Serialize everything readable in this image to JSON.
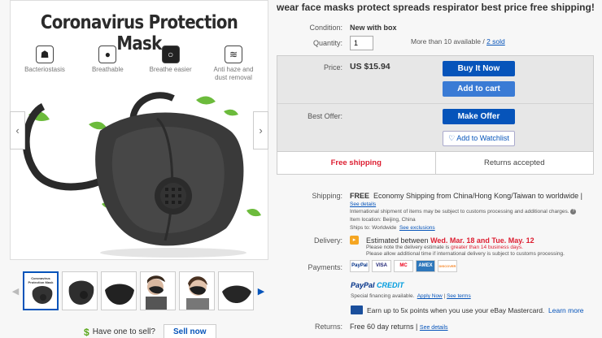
{
  "gallery": {
    "hero_title": "Coronavirus Protection Mask",
    "features": [
      {
        "label": "Bacteriostasis",
        "icon": "cat-face-icon"
      },
      {
        "label": "Breathable",
        "icon": "droplet-icon"
      },
      {
        "label": "Breathe easier",
        "icon": "ring-icon"
      },
      {
        "label": "Anti haze and dust removal",
        "icon": "haze-icon"
      }
    ],
    "thumb_title": "Coronavirus Protection Mask"
  },
  "sell": {
    "dollar_icon": "$",
    "text": "Have one to sell?",
    "button": "Sell now"
  },
  "listing": {
    "title": "wear face masks protect spreads respirator best price free shipping!",
    "condition_label": "Condition:",
    "condition_value": "New with box",
    "quantity_label": "Quantity:",
    "quantity_value": "1",
    "available_text": "More than 10 available / ",
    "sold_link": "2 sold",
    "price_label": "Price:",
    "price": "US $15.94",
    "buy_now": "Buy It Now",
    "add_to_cart": "Add to cart",
    "best_offer_label": "Best Offer:",
    "make_offer": "Make Offer",
    "watchlist": "Add to Watchlist",
    "free_shipping": "Free shipping",
    "returns_accepted": "Returns accepted"
  },
  "shipping": {
    "label": "Shipping:",
    "free": "FREE",
    "method": "Economy Shipping from China/Hong Kong/Taiwan to worldwide |",
    "see_details": "See details",
    "intl_note": "International shipment of items may be subject to customs processing and additional charges.",
    "item_location": "Item location:  Beijing, China",
    "ships_to": "Ships to:  Worldwide",
    "see_exclusions": "See exclusions"
  },
  "delivery": {
    "label": "Delivery:",
    "estimated": "Estimated between",
    "dates": "Wed. Mar. 18 and Tue. May. 12",
    "note_prefix": "Please note the delivery estimate is",
    "note_highlight": "greater than 14 business days.",
    "note2": "Please allow additional time if international delivery is subject to customs processing."
  },
  "payments": {
    "label": "Payments:",
    "logos": [
      "PayPal",
      "VISA",
      "MC",
      "AMEX",
      "DISCOVER"
    ],
    "pp_credit_1": "PayPal",
    "pp_credit_2": "CREDIT",
    "special": "Special financing available.",
    "apply_now": "Apply Now",
    "see_terms": "See terms",
    "earn": "Earn up to 5x points when you use your eBay Mastercard.",
    "learn_more": "Learn more"
  },
  "returns": {
    "label": "Returns:",
    "value": "Free 60 day returns |",
    "see_details": "See details"
  }
}
